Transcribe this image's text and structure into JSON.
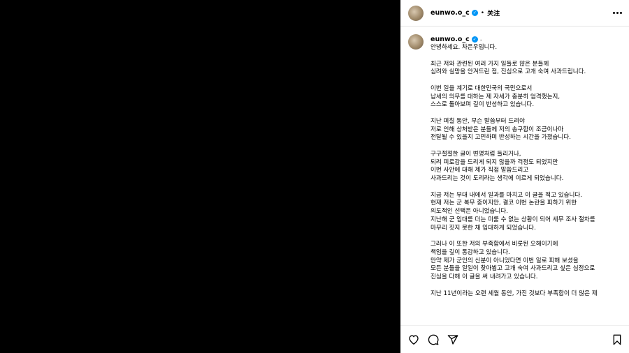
{
  "header": {
    "username": "eunwo.o_c",
    "dot": "•",
    "follow_label": "关注"
  },
  "post": {
    "username": "eunwo.o_c",
    "caption": "안녕하세요. 차은우입니다.\n\n최근 저와 관련된 여러 가지 일들로 많은 분들께\n심려와 실망을 안겨드린 점, 진심으로 고개 숙여 사과드립니다.\n\n이번 일을 계기로 대한민국의 국민으로서\n납세의 의무를 대하는 제 자세가 충분히 엄격했는지,\n스스로 돌아보며 깊이 반성하고 있습니다.\n\n지난 며칠 동안, 무슨 말씀부터 드려야\n저로 인해 상처받은 분들께 저의 송구함이 조금이나마\n전달될 수 있을지 고민하며 반성하는 시간을 가졌습니다.\n\n구구절절한 글이 변명처럼 들리거나,\n되려 피로감을 드리게 되지 않을까 걱정도 되었지만\n이번 사안에 대해 제가 직접 말씀드리고\n사과드리는 것이 도리라는 생각에 이르게 되었습니다.\n\n지금 저는 부대 내에서 일과를 마치고 이 글을 적고 있습니다.\n현재 저는 군 복무 중이지만, 결코 이번 논란을 피하기 위한\n의도적인 선택은 아니었습니다.\n지난해 군 입대를 더는 미룰 수 없는 상황이 되어 세무 조사 절차를\n마무리 짓지 못한 채 입대하게 되었습니다.\n\n그러나 이 또한 저의 부족함에서 비롯된 오해이기에\n책임을 깊이 통감하고 있습니다.\n만약 제가 군인의 신분이 아니었다면 이번 일로 피해 보셨을\n모든 분들을 일일이 찾아뵙고 고개 숙여 사과드리고 싶은 심정으로\n진심을 다해 이 글을 써 내려가고 있습니다.\n\n지난 11년이라는 오랜 세월 동안, 가진 것보다 부족함이 더 많은 제"
  },
  "icons": {
    "verified": "verified-badge-icon",
    "more": "more-options-icon",
    "like": "heart-icon",
    "comment": "comment-icon",
    "share": "share-icon",
    "save": "bookmark-icon"
  },
  "colors": {
    "verified_blue": "#0095f6",
    "media_bg": "#000000"
  }
}
